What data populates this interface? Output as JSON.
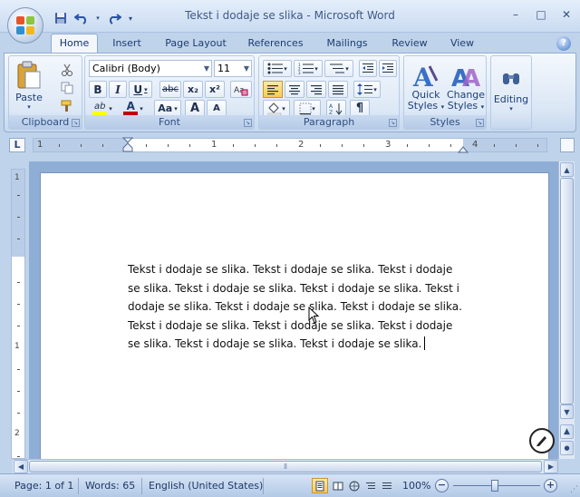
{
  "window": {
    "title": "Tekst i dodaje se slika - Microsoft Word",
    "controls": [
      "–",
      "□",
      "✕"
    ]
  },
  "tabs": [
    {
      "label": "Home",
      "active": true
    },
    {
      "label": "Insert"
    },
    {
      "label": "Page Layout"
    },
    {
      "label": "References"
    },
    {
      "label": "Mailings"
    },
    {
      "label": "Review"
    },
    {
      "label": "View"
    }
  ],
  "ribbon": {
    "clipboard": {
      "group_label": "Clipboard",
      "paste_label": "Paste"
    },
    "font": {
      "group_label": "Font",
      "font_name": "Calibri (Body)",
      "font_size": "11",
      "bold": "B",
      "italic": "I",
      "underline": "U",
      "strikethrough": "abc",
      "subscript": "x₂",
      "superscript": "x²",
      "change_case": "Aa",
      "grow_font": "A",
      "shrink_font": "A",
      "font_color": "A",
      "highlight": "ab"
    },
    "paragraph": {
      "group_label": "Paragraph",
      "pilcrow": "¶"
    },
    "styles": {
      "group_label": "Styles",
      "quick_styles": [
        "Quick",
        "Styles"
      ],
      "change_styles": [
        "Change",
        "Styles"
      ]
    },
    "editing": {
      "label": "Editing"
    }
  },
  "ruler": {
    "numbers": [
      "1",
      "1",
      "2",
      "3",
      "4"
    ]
  },
  "vruler": {
    "numbers": [
      "1",
      "1",
      "2"
    ]
  },
  "document": {
    "lines": [
      "Tekst i dodaje se slika. Tekst i dodaje se slika. Tekst i dodaje",
      "se slika. Tekst i dodaje se slika. Tekst i dodaje se slika. Tekst i",
      "dodaje se slika. Tekst i dodaje se slika. Tekst i dodaje se slika.",
      "Tekst i dodaje se slika. Tekst i dodaje se slika. Tekst i dodaje",
      "se slika. Tekst i dodaje se slika. Tekst i dodaje se slika."
    ]
  },
  "status": {
    "page": "Page: 1 of 1",
    "words": "Words: 65",
    "language": "English (United States)",
    "zoom": "100%",
    "zoom_out": "−",
    "zoom_in": "+"
  },
  "colors": {
    "accent": "#1e3d72",
    "chrome": "#bfd3ea",
    "highlight": "#ffff00",
    "font_color": "#c00000"
  }
}
